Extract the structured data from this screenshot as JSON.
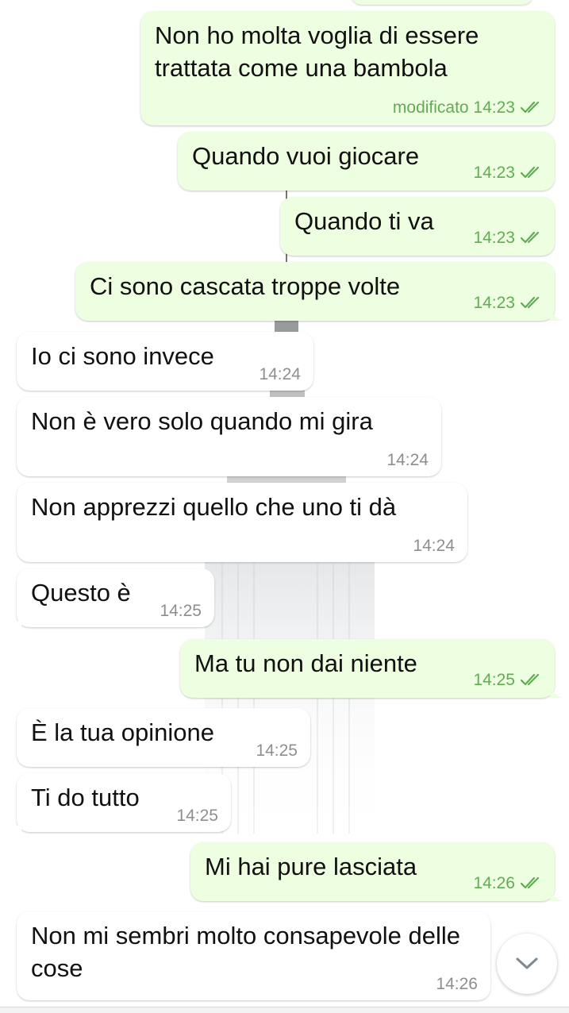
{
  "messages": [
    {
      "id": "m1",
      "dir": "out",
      "text": "Non ho molta voglia di essere trattata come una bambola",
      "time": "modificato 14:23",
      "checks": true
    },
    {
      "id": "m2",
      "dir": "out",
      "text": "Quando vuoi giocare",
      "time": "14:23",
      "checks": true
    },
    {
      "id": "m3",
      "dir": "out",
      "text": "Quando ti va",
      "time": "14:23",
      "checks": true
    },
    {
      "id": "m4",
      "dir": "out",
      "text": "Ci sono cascata troppe volte",
      "time": "14:23",
      "checks": true
    },
    {
      "id": "m5",
      "dir": "in",
      "text": "Io ci sono invece",
      "time": "14:24"
    },
    {
      "id": "m6",
      "dir": "in",
      "text": "Non è vero solo quando mi gira",
      "time": "14:24"
    },
    {
      "id": "m7",
      "dir": "in",
      "text": "Non apprezzi quello che uno ti dà",
      "time": "14:24"
    },
    {
      "id": "m8",
      "dir": "in",
      "text": "Questo è",
      "time": "14:25"
    },
    {
      "id": "m9",
      "dir": "out",
      "text": "Ma tu non dai niente",
      "time": "14:25",
      "checks": true
    },
    {
      "id": "m10",
      "dir": "in",
      "text": "È la tua opinione",
      "time": "14:25"
    },
    {
      "id": "m11",
      "dir": "in",
      "text": "Ti do tutto",
      "time": "14:25"
    },
    {
      "id": "m12",
      "dir": "out",
      "text": "Mi hai pure lasciata",
      "time": "14:26",
      "checks": true
    },
    {
      "id": "m13",
      "dir": "in",
      "text": "Non mi sembri molto consapevole delle cose",
      "time": "14:26"
    }
  ],
  "colors": {
    "outgoing_bubble": "#eefee0",
    "incoming_bubble": "#ffffff",
    "outgoing_meta": "#62ac55",
    "incoming_meta": "#8e8e8e",
    "read_checks": "#62ac55"
  },
  "icons": {
    "read_receipt": "double-check-icon",
    "scroll_down": "chevron-down-icon"
  }
}
